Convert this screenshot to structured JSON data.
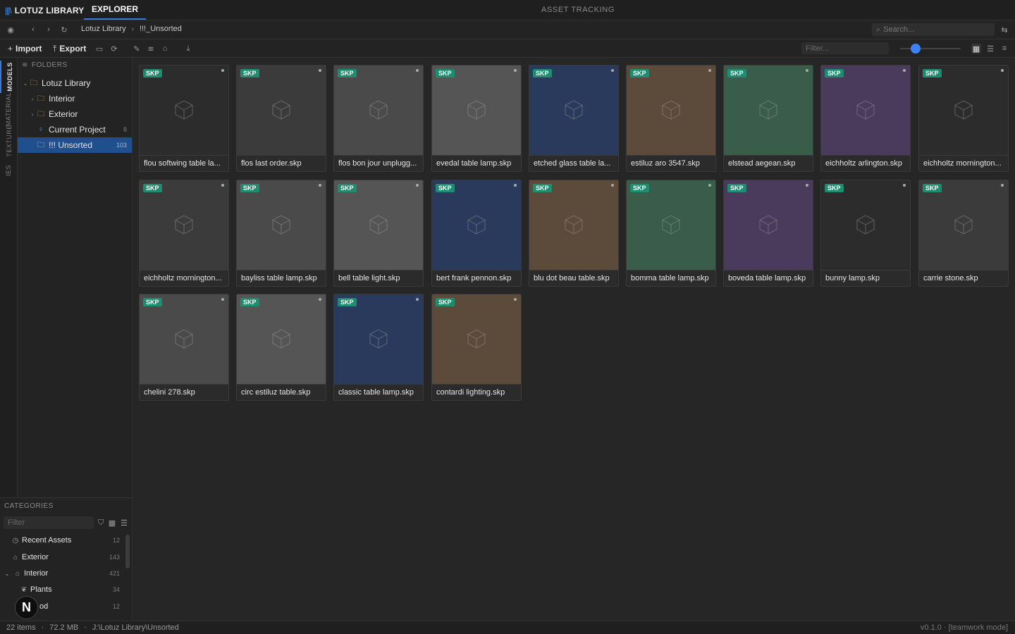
{
  "app": {
    "brand": "LOTUZ LIBRARY",
    "tab_explorer": "EXPLORER",
    "tab_asset": "ASSET TRACKING"
  },
  "nav": {
    "breadcrumb": [
      "Lotuz Library",
      "!!!_Unsorted"
    ],
    "search_placeholder": "Search..."
  },
  "toolbar": {
    "import_label": "Import",
    "export_label": "Export",
    "filter_placeholder": "Filter...",
    "thumb_size": 0.25
  },
  "vtabs": [
    "MODELS",
    "MATERIAL",
    "TEXTURE",
    "IES"
  ],
  "folders": {
    "heading": "FOLDERS",
    "items": [
      {
        "label": "Lotuz Library",
        "count": ""
      },
      {
        "label": "Interior",
        "count": ""
      },
      {
        "label": "Exterior",
        "count": ""
      },
      {
        "label": "Current Project",
        "count": "8"
      },
      {
        "label": "!!! Unsorted",
        "count": "103"
      }
    ]
  },
  "categories": {
    "heading": "CATEGORIES",
    "filter_placeholder": "Filter",
    "items": [
      {
        "label": "Recent Assets",
        "count": "12"
      },
      {
        "label": "Exterior",
        "count": "143"
      },
      {
        "label": "Interior",
        "count": "421"
      },
      {
        "label": "Plants",
        "count": "34"
      },
      {
        "label": "od",
        "count": "12"
      }
    ]
  },
  "assets": [
    {
      "name": "flou softwing table la...",
      "badge": "SKP",
      "color": "#2c2c2c"
    },
    {
      "name": "flos last order.skp",
      "badge": "SKP",
      "color": "#3b3b3b"
    },
    {
      "name": "flos bon jour unplugg...",
      "badge": "SKP",
      "color": "#4a4a4a"
    },
    {
      "name": "evedal table lamp.skp",
      "badge": "SKP",
      "color": "#555555"
    },
    {
      "name": "etched glass table la...",
      "badge": "SKP",
      "color": "#2a3a5c"
    },
    {
      "name": "estiluz aro 3547.skp",
      "badge": "SKP",
      "color": "#5c4a3a"
    },
    {
      "name": "elstead aegean.skp",
      "badge": "SKP",
      "color": "#3a5c4a"
    },
    {
      "name": "eichholtz arlington.skp",
      "badge": "SKP",
      "color": "#4a3a5c"
    },
    {
      "name": "eichholtz mornington...",
      "badge": "SKP",
      "color": "#2c2c2c"
    },
    {
      "name": "eichholtz mornington...",
      "badge": "SKP",
      "color": "#3b3b3b"
    },
    {
      "name": "bayliss table lamp.skp",
      "badge": "SKP",
      "color": "#4a4a4a"
    },
    {
      "name": "bell table light.skp",
      "badge": "SKP",
      "color": "#555555"
    },
    {
      "name": "bert frank pennon.skp",
      "badge": "SKP",
      "color": "#2a3a5c"
    },
    {
      "name": "blu dot beau table.skp",
      "badge": "SKP",
      "color": "#5c4a3a"
    },
    {
      "name": "bomma table lamp.skp",
      "badge": "SKP",
      "color": "#3a5c4a"
    },
    {
      "name": "boveda table lamp.skp",
      "badge": "SKP",
      "color": "#4a3a5c"
    },
    {
      "name": "bunny lamp.skp",
      "badge": "SKP",
      "color": "#2c2c2c"
    },
    {
      "name": "carrie stone.skp",
      "badge": "SKP",
      "color": "#3b3b3b"
    },
    {
      "name": "chelini 278.skp",
      "badge": "SKP",
      "color": "#4a4a4a"
    },
    {
      "name": "circ estiluz table.skp",
      "badge": "SKP",
      "color": "#555555"
    },
    {
      "name": "classic table lamp.skp",
      "badge": "SKP",
      "color": "#2a3a5c"
    },
    {
      "name": "contardi lighting.skp",
      "badge": "SKP",
      "color": "#5c4a3a"
    }
  ],
  "status": {
    "items": "22 items",
    "size": "72.2 MB",
    "path": "J:\\Lotuz Library\\Unsorted",
    "version": "v0.1.0 · [teamwork mode]"
  },
  "avatar": "N"
}
